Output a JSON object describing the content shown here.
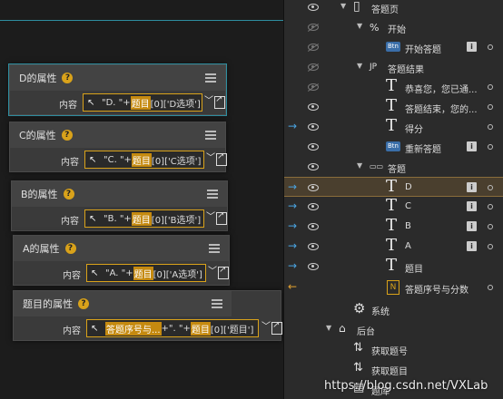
{
  "canvas": {
    "cards": [
      {
        "title": "D的属性",
        "prop_label": "内容",
        "expr_pre": "\"D. \"+",
        "expr_var": "题目",
        "expr_post": "[0]['D选项']"
      },
      {
        "title": "C的属性",
        "prop_label": "内容",
        "expr_pre": "\"C. \"+",
        "expr_var": "题目",
        "expr_post": "[0]['C选项']"
      },
      {
        "title": "B的属性",
        "prop_label": "内容",
        "expr_pre": "\"B. \"+",
        "expr_var": "题目",
        "expr_post": "[0]['B选项']"
      },
      {
        "title": "A的属性",
        "prop_label": "内容",
        "expr_pre": "\"A. \"+",
        "expr_var": "题目",
        "expr_post": "[0]['A选项']"
      },
      {
        "title": "题目的属性",
        "prop_label": "内容",
        "expr_var0": "答题序号与...",
        "expr_pre": "+\". \"+",
        "expr_var": "题目",
        "expr_post": "[0]['题目']"
      }
    ],
    "help_glyph": "?",
    "cursor_glyph": "↖",
    "chevron_glyph": "﹀"
  },
  "tree": {
    "rows": [
      {
        "label": "答题页",
        "icon": "page-icon",
        "glyph": "▯"
      },
      {
        "label": "开始",
        "icon": "group-icon",
        "glyph": "%"
      },
      {
        "label": "开始答题",
        "icon": "button-icon",
        "glyph": "Btn"
      },
      {
        "label": "答题结果",
        "icon": "group-icon",
        "glyph": "JP"
      },
      {
        "label": "恭喜您，您已通...",
        "icon": "text-icon",
        "glyph": "T"
      },
      {
        "label": "答题结束，您的...",
        "icon": "text-icon",
        "glyph": "T"
      },
      {
        "label": "得分",
        "icon": "text-icon",
        "glyph": "T"
      },
      {
        "label": "重新答题",
        "icon": "button-icon",
        "glyph": "Btn"
      },
      {
        "label": "答题",
        "icon": "group-icon",
        "glyph": "▭▭"
      },
      {
        "label": "D",
        "icon": "text-icon",
        "glyph": "T"
      },
      {
        "label": "C",
        "icon": "text-icon",
        "glyph": "T"
      },
      {
        "label": "B",
        "icon": "text-icon",
        "glyph": "T"
      },
      {
        "label": "A",
        "icon": "text-icon",
        "glyph": "T"
      },
      {
        "label": "题目",
        "icon": "text-icon",
        "glyph": "T"
      },
      {
        "label": "答题序号与分数",
        "icon": "number-icon",
        "glyph": "N"
      },
      {
        "label": "系统",
        "icon": "gear-icon",
        "glyph": "⚙"
      },
      {
        "label": "后台",
        "icon": "backend-icon",
        "glyph": "⌂"
      },
      {
        "label": "获取题号",
        "icon": "fetch-icon",
        "glyph": "⇅"
      },
      {
        "label": "获取题目",
        "icon": "fetch-icon",
        "glyph": "⇅"
      },
      {
        "label": "题库",
        "icon": "db-icon",
        "glyph": "▤"
      }
    ],
    "info_glyph": "i",
    "arrow_glyph": "→",
    "back_arrow_glyph": "←",
    "expand_glyph": "▼"
  },
  "watermark": "https://blog.csdn.net/VXLab",
  "colors": {
    "accent": "#d9a21a",
    "selection": "#4a3f2e",
    "link_arrow": "#4aa3e0"
  }
}
